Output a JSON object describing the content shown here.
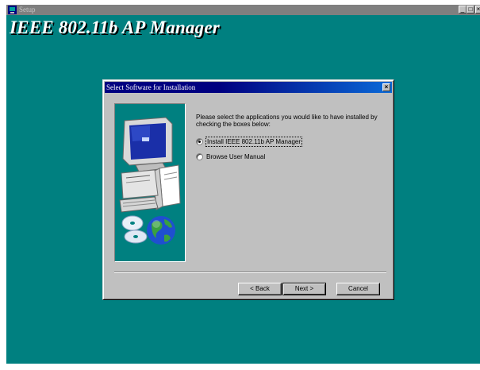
{
  "window": {
    "title": "Setup",
    "controls": {
      "minimize": "_",
      "maximize": "□",
      "close": "×"
    }
  },
  "app": {
    "heading": "IEEE 802.11b AP Manager"
  },
  "dialog": {
    "title": "Select Software for Installation",
    "close": "×",
    "prompt": "Please select the applications you would like to have installed by checking the boxes below:",
    "options": [
      {
        "label": "Install IEEE 802.11b AP Manager",
        "selected": true
      },
      {
        "label": "Browse User Manual",
        "selected": false
      }
    ],
    "buttons": {
      "back": "< Back",
      "next": "Next >",
      "cancel": "Cancel"
    }
  },
  "colors": {
    "desktop": "#008080",
    "dialog_face": "#c0c0c0",
    "title_active": "#000080"
  }
}
